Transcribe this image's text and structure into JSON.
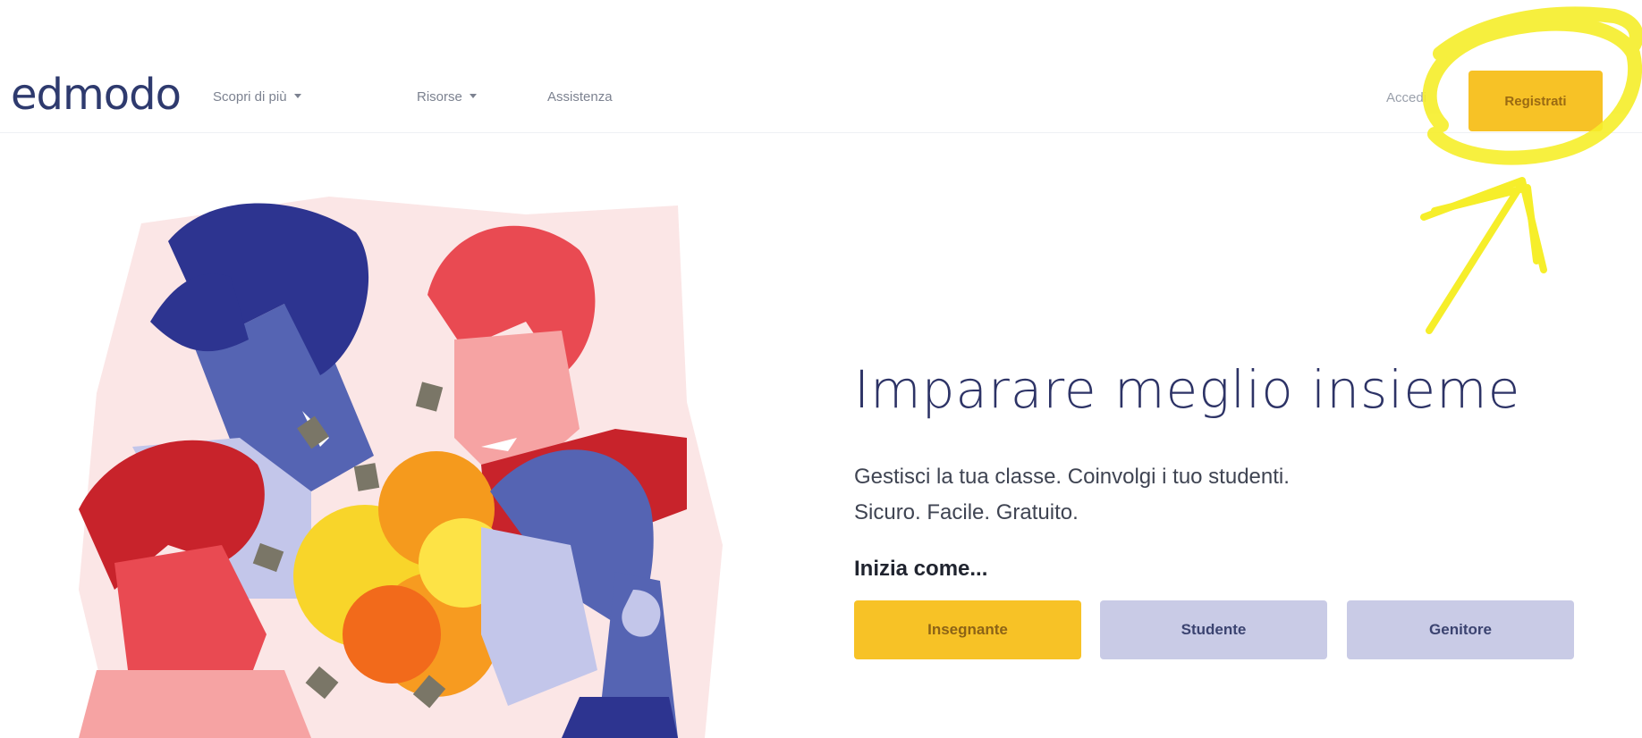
{
  "header": {
    "logo": "edmodo",
    "nav": [
      {
        "label": "Scopri di più",
        "has_dropdown": true
      },
      {
        "label": "Risorse",
        "has_dropdown": true
      },
      {
        "label": "Assistenza",
        "has_dropdown": false
      }
    ],
    "login_label": "Accedi",
    "register_label": "Registrati"
  },
  "hero": {
    "title": "Imparare meglio insieme",
    "subtitle_line1": "Gestisci la tua classe. Coinvolgi i tuo studenti.",
    "subtitle_line2": "Sicuro. Facile. Gratuito.",
    "start_label": "Inizia come...",
    "roles": [
      {
        "label": "Insegnante"
      },
      {
        "label": "Studente"
      },
      {
        "label": "Genitore"
      }
    ]
  },
  "colors": {
    "brand": "#2e3a6e",
    "accent_yellow": "#f7c226",
    "role_secondary": "#c9cbe6",
    "annotation_highlight": "#f6ee2a"
  },
  "icons": [
    "chevron-down-icon",
    "highlight-circle",
    "annotation-arrow"
  ]
}
